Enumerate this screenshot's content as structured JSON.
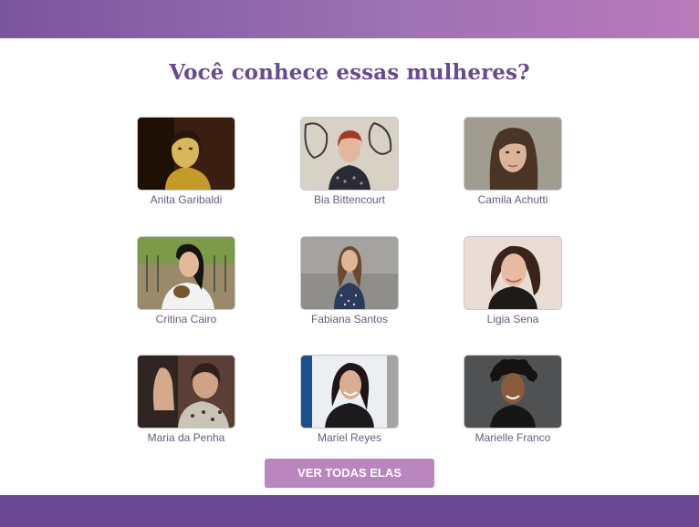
{
  "title": "Você conhece essas mulheres?",
  "women": [
    {
      "name": "Anita Garibaldi"
    },
    {
      "name": "Bia Bittencourt"
    },
    {
      "name": "Camila Achutti"
    },
    {
      "name": "Critina Cairo"
    },
    {
      "name": "Fabiana Santos"
    },
    {
      "name": "Ligia Sena"
    },
    {
      "name": "Maria da Penha"
    },
    {
      "name": "Mariel Reyes"
    },
    {
      "name": "Marielle Franco"
    }
  ],
  "button_label": "VER TODAS ELAS",
  "colors": {
    "header_start": "#7a559e",
    "header_end": "#b97ab8",
    "title": "#6a4a8f",
    "button": "#b986bf",
    "footer": "#6a4891"
  }
}
